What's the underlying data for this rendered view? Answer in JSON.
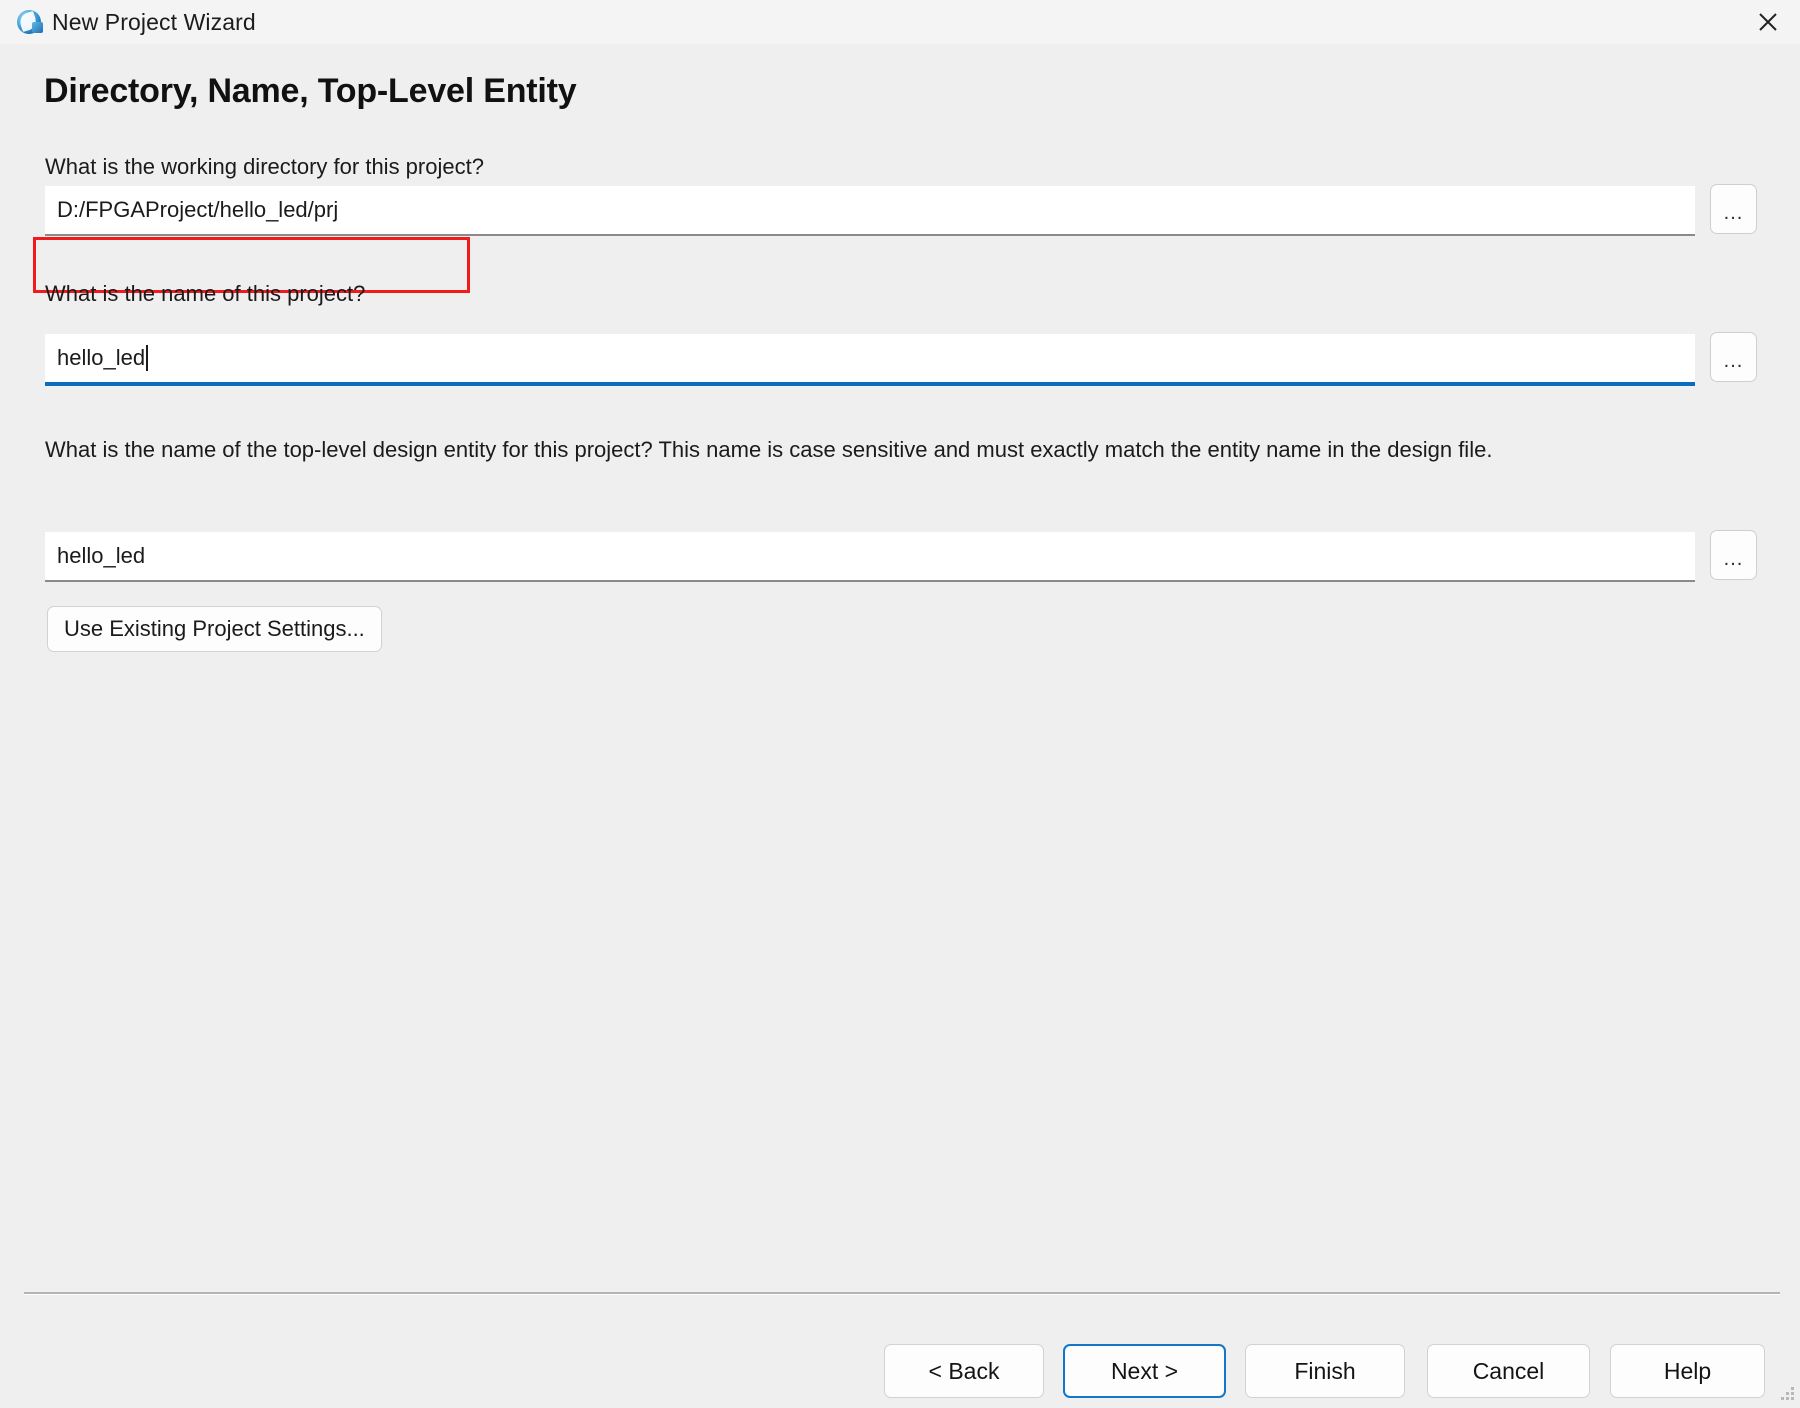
{
  "window": {
    "title": "New Project Wizard",
    "icon": "quartus-sphere-icon",
    "close_label": "close-icon"
  },
  "page": {
    "heading": "Directory, Name, Top-Level Entity"
  },
  "fields": [
    {
      "label": "What is the working directory for this project?",
      "value": "D:/FPGAProject/hello_led/prj",
      "browse_label": "...",
      "focused": false,
      "highlighted": true
    },
    {
      "label": "What is the name of this project?",
      "value": "hello_led",
      "browse_label": "...",
      "focused": true,
      "highlighted": false
    },
    {
      "label": "What is the name of the top-level design entity for this project? This name is case sensitive and must exactly match the entity name in the design file.",
      "value": "hello_led",
      "browse_label": "...",
      "focused": false,
      "highlighted": false
    }
  ],
  "existing_settings": {
    "label": "Use Existing Project Settings..."
  },
  "footer": {
    "back": "< Back",
    "next": "Next >",
    "finish": "Finish",
    "cancel": "Cancel",
    "help": "Help"
  },
  "colors": {
    "accent": "#0a6cc0",
    "highlight": "#f01b1b",
    "titlebar_bg": "#f4f4f4",
    "content_bg": "#efefef"
  }
}
